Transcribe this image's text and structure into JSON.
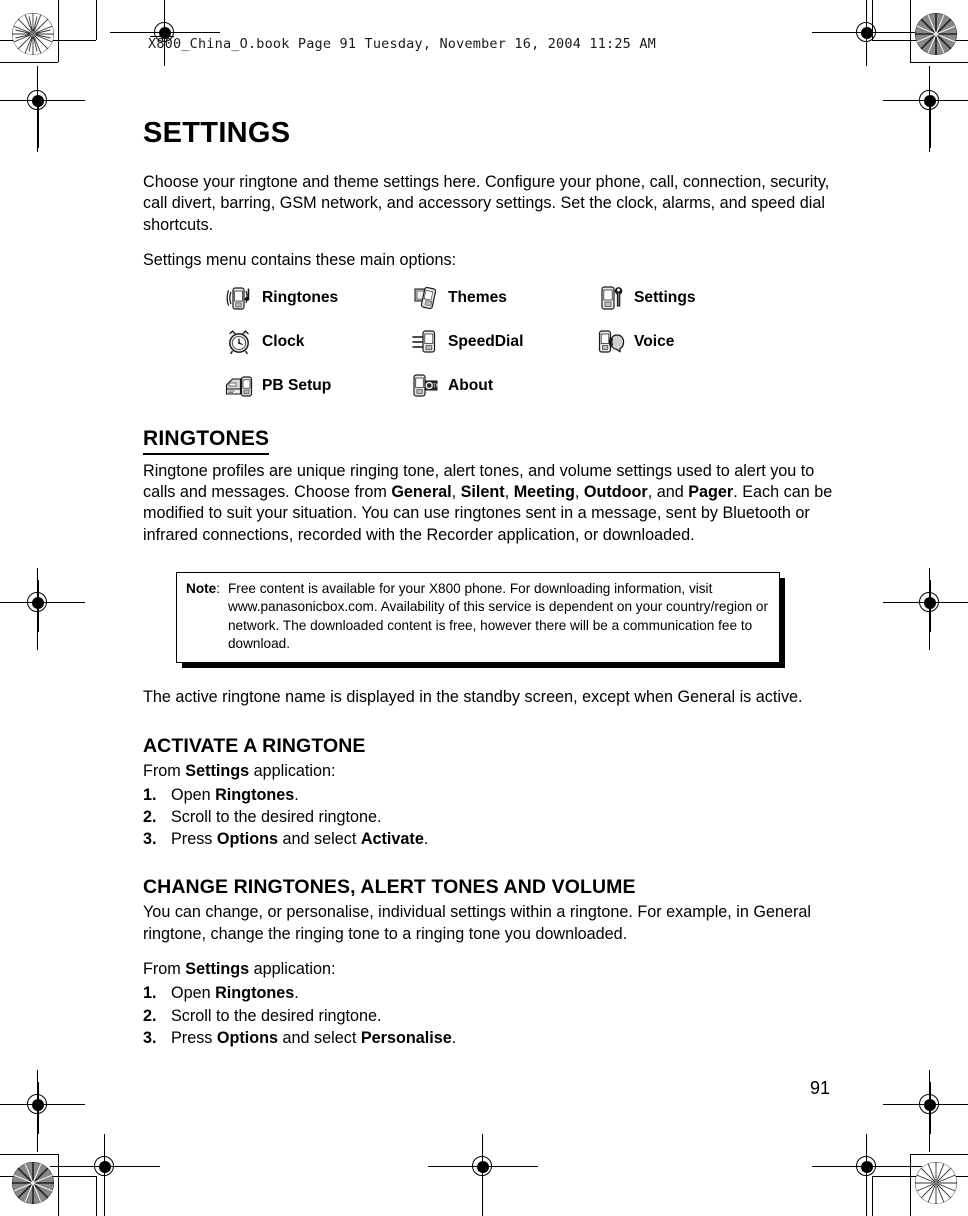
{
  "print_header": {
    "text": "X800_China_O.book  Page 91  Tuesday, November 16, 2004  11:25 AM"
  },
  "page": {
    "number": "91",
    "title": "SETTINGS"
  },
  "intro": {
    "paragraph_1": "Choose your ringtone and theme settings here. Configure your phone, call, connection, security, call divert, barring, GSM network, and accessory settings. Set the clock, alarms, and speed dial shortcuts.",
    "paragraph_2": "Settings menu contains these main options:"
  },
  "menu_options": [
    {
      "label": "Ringtones",
      "icon": "phone-ringtone-icon"
    },
    {
      "label": "Themes",
      "icon": "phone-themes-icon"
    },
    {
      "label": "Settings",
      "icon": "phone-settings-icon"
    },
    {
      "label": "Clock",
      "icon": "alarm-clock-icon"
    },
    {
      "label": "SpeedDial",
      "icon": "phone-speeddial-icon"
    },
    {
      "label": "Voice",
      "icon": "phone-voice-icon"
    },
    {
      "label": "PB Setup",
      "icon": "phonebook-setup-icon"
    },
    {
      "label": "About",
      "icon": "phone-about-icon"
    }
  ],
  "ringtones": {
    "heading": "RINGTONES",
    "intro_part_1": "Ringtone profiles are unique ringing tone, alert tones, and volume settings used to alert you to calls and messages. Choose from ",
    "profile_general": "General",
    "sep_1": ", ",
    "profile_silent": "Silent",
    "sep_2": ", ",
    "profile_meeting": "Meeting",
    "sep_3": ", ",
    "profile_outdoor": "Outdoor",
    "sep_4": ", and ",
    "profile_pager": "Pager",
    "intro_part_2": ". Each can be modified to suit your situation. You can use ringtones sent in a message, sent by Bluetooth or infrared connections, recorded with the Recorder application, or downloaded.",
    "standby_note": "The active ringtone name is displayed in the standby screen, except when General is active."
  },
  "note": {
    "label": "Note",
    "colon": ":",
    "text": "Free content is available for your X800 phone. For downloading information, visit www.panasonicbox.com. Availability of this service is dependent on your country/region or network. The downloaded content is free, however there will be a communication fee to download."
  },
  "activate_ringtone": {
    "heading": "ACTIVATE A RINGTONE",
    "from_prefix": "From ",
    "from_app": "Settings",
    "from_suffix": " application:",
    "steps": [
      {
        "num": "1.",
        "pre": "Open ",
        "bold": "Ringtones",
        "post": "."
      },
      {
        "num": "2.",
        "pre": "Scroll to the desired ringtone.",
        "bold": "",
        "post": ""
      },
      {
        "num": "3.",
        "pre": "Press ",
        "bold": "Options",
        "post": " and select ",
        "bold2": "Activate",
        "post2": "."
      }
    ]
  },
  "change_ringtones": {
    "heading": "CHANGE RINGTONES, ALERT TONES AND VOLUME",
    "body": "You can change, or personalise, individual settings within a ringtone. For example, in General ringtone, change the ringing tone to a ringing tone you downloaded.",
    "from_prefix": "From ",
    "from_app": "Settings",
    "from_suffix": " application:",
    "steps": [
      {
        "num": "1.",
        "pre": "Open ",
        "bold": "Ringtones",
        "post": "."
      },
      {
        "num": "2.",
        "pre": "Scroll to the desired ringtone.",
        "bold": "",
        "post": ""
      },
      {
        "num": "3.",
        "pre": "Press ",
        "bold": "Options",
        "post": " and select ",
        "bold2": "Personalise",
        "post2": "."
      }
    ]
  }
}
